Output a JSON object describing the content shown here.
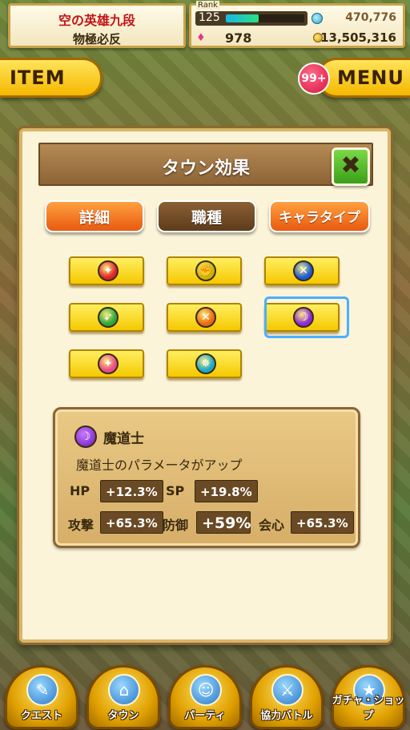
{
  "title_plate": {
    "line1": "空の英雄九段",
    "line2": "物極必反"
  },
  "stats": {
    "rank_label": "Rank",
    "rank_value": "125",
    "rank_progress": 0.42,
    "stamina_value": "470,776",
    "gems_value": "978",
    "coins_value": "13,505,316"
  },
  "item_button": {
    "label": "ITEM"
  },
  "menu_button": {
    "label": "MENU",
    "badge": "99+"
  },
  "dialog": {
    "title": "タウン効果",
    "close_label": "✖",
    "tabs": [
      {
        "label": "詳細",
        "style": "orange"
      },
      {
        "label": "職種",
        "style": "brown"
      },
      {
        "label": "キャラタイプ",
        "style": "orange"
      }
    ],
    "job_buttons": [
      {
        "icon": "sword-icon",
        "glyph": "✦",
        "color": "#e0242a",
        "selected": false
      },
      {
        "icon": "fist-icon",
        "glyph": "✊",
        "color": "#c8b400",
        "selected": false
      },
      {
        "icon": "axe-icon",
        "glyph": "✕",
        "color": "#1a5ad8",
        "selected": false
      },
      {
        "icon": "bow-icon",
        "glyph": "➶",
        "color": "#2aa83a",
        "selected": false
      },
      {
        "icon": "crossbow-icon",
        "glyph": "✕",
        "color": "#e86a10",
        "selected": false
      },
      {
        "icon": "staff-icon",
        "glyph": "☽",
        "color": "#8a2ad8",
        "selected": true
      },
      {
        "icon": "dual-blade-icon",
        "glyph": "✦",
        "color": "#e84a8a",
        "selected": false
      },
      {
        "icon": "shuriken-icon",
        "glyph": "✵",
        "color": "#1aa8c8",
        "selected": false
      }
    ],
    "info": {
      "job_name": "魔道士",
      "description": "魔道士のパラメータがアップ",
      "hp_label": "HP",
      "hp_value": "+12.3%",
      "sp_label": "SP",
      "sp_value": "+19.8%",
      "atk_label": "攻撃",
      "atk_value": "+65.3%",
      "def_label": "防御",
      "def_value": "+59%",
      "crit_label": "会心",
      "crit_value": "+65.3%"
    }
  },
  "bottom_nav": [
    {
      "label": "クエスト",
      "icon": "quest-map-icon",
      "glyph": "✎"
    },
    {
      "label": "タウン",
      "icon": "town-icon",
      "glyph": "⌂"
    },
    {
      "label": "パーティ",
      "icon": "party-icon",
      "glyph": "☺"
    },
    {
      "label": "協力バトル",
      "icon": "coop-battle-icon",
      "glyph": "⚔"
    },
    {
      "label": "ガチャ・ショップ",
      "icon": "gacha-shop-icon",
      "glyph": "★"
    }
  ]
}
